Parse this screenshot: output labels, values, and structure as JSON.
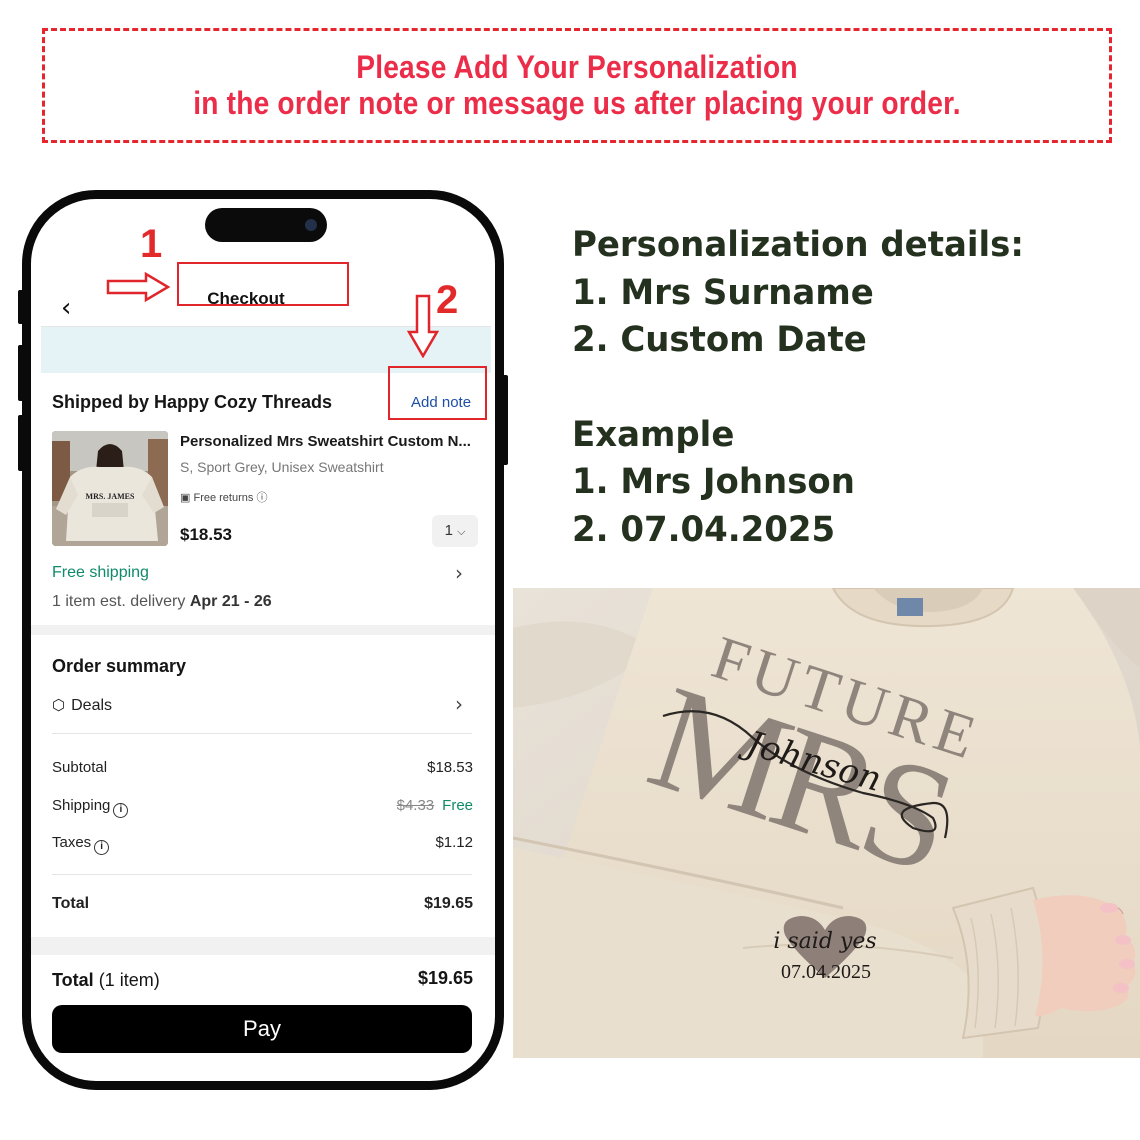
{
  "banner": {
    "line1": "Please Add Your Personalization",
    "line2": "in the order note or message us after placing your order."
  },
  "annotations": {
    "step1": "1",
    "step2": "2"
  },
  "checkout": {
    "title": "Checkout",
    "seller": "Shipped by Happy Cozy Threads",
    "add_note": "Add note",
    "product": {
      "title": "Personalized Mrs Sweatshirt Custom N...",
      "variant": "S, Sport Grey, Unisex Sweatshirt",
      "returns": "Free returns",
      "price": "$18.53",
      "qty": "1",
      "thumb_text": "MRS. JAMES"
    },
    "shipping": {
      "label": "Free shipping",
      "delivery_prefix": "1 item est. delivery ",
      "delivery_dates": "Apr 21 - 26"
    },
    "summary": {
      "title": "Order summary",
      "deals": "Deals",
      "subtotal_label": "Subtotal",
      "subtotal_value": "$18.53",
      "shipping_label": "Shipping",
      "shipping_old": "$4.33",
      "shipping_value": "Free",
      "taxes_label": "Taxes",
      "taxes_value": "$1.12",
      "total_label": "Total",
      "total_value": "$19.65"
    },
    "footer": {
      "total_label": "Total",
      "total_items": "(1 item)",
      "total_value": "$19.65",
      "pay": "Pay"
    }
  },
  "details": {
    "heading": "Personalization details:",
    "item1": "1. Mrs Surname",
    "item2": "2. Custom Date",
    "example_heading": "Example",
    "example1": "1. Mrs Johnson",
    "example2": "2. 07.04.2025"
  },
  "sweatshirt": {
    "future": "FUTURE",
    "mrs": "MRS",
    "name": "Johnson",
    "said": "i said yes",
    "date": "07.04.2025"
  },
  "colors": {
    "banner_red": "#ec2d49",
    "annotation_red": "#e0262a",
    "details_green": "#24311f",
    "shipping_green": "#0f8a6a",
    "link_blue": "#1d4fa6",
    "shirt_cream": "#ece1d0",
    "print_taupe": "#8f857c"
  }
}
